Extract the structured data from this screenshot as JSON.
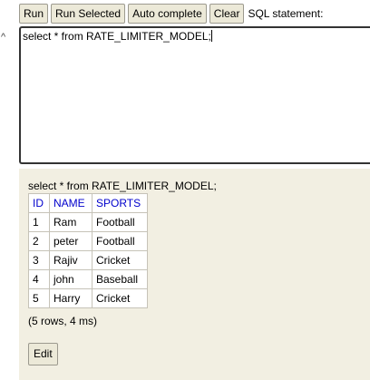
{
  "toolbar": {
    "run_label": "Run",
    "run_selected_label": "Run Selected",
    "auto_complete_label": "Auto complete",
    "clear_label": "Clear",
    "sql_statement_label": "SQL statement:"
  },
  "editor": {
    "value": "select * from RATE_LIMITER_MODEL;"
  },
  "result": {
    "query": "select * from RATE_LIMITER_MODEL;",
    "columns": [
      "ID",
      "NAME",
      "SPORTS"
    ],
    "rows": [
      [
        "1",
        "Ram",
        "Football"
      ],
      [
        "2",
        "peter",
        "Football"
      ],
      [
        "3",
        "Rajiv",
        "Cricket"
      ],
      [
        "4",
        "john",
        "Baseball"
      ],
      [
        "5",
        "Harry",
        "Cricket"
      ]
    ],
    "footer": "(5 rows, 4 ms)",
    "edit_label": "Edit"
  },
  "colors": {
    "header_text": "#0000cc",
    "panel_background": "#f2efe2",
    "button_background": "#ece9d8"
  },
  "icons": {
    "left_marker": "caret-up-icon"
  }
}
